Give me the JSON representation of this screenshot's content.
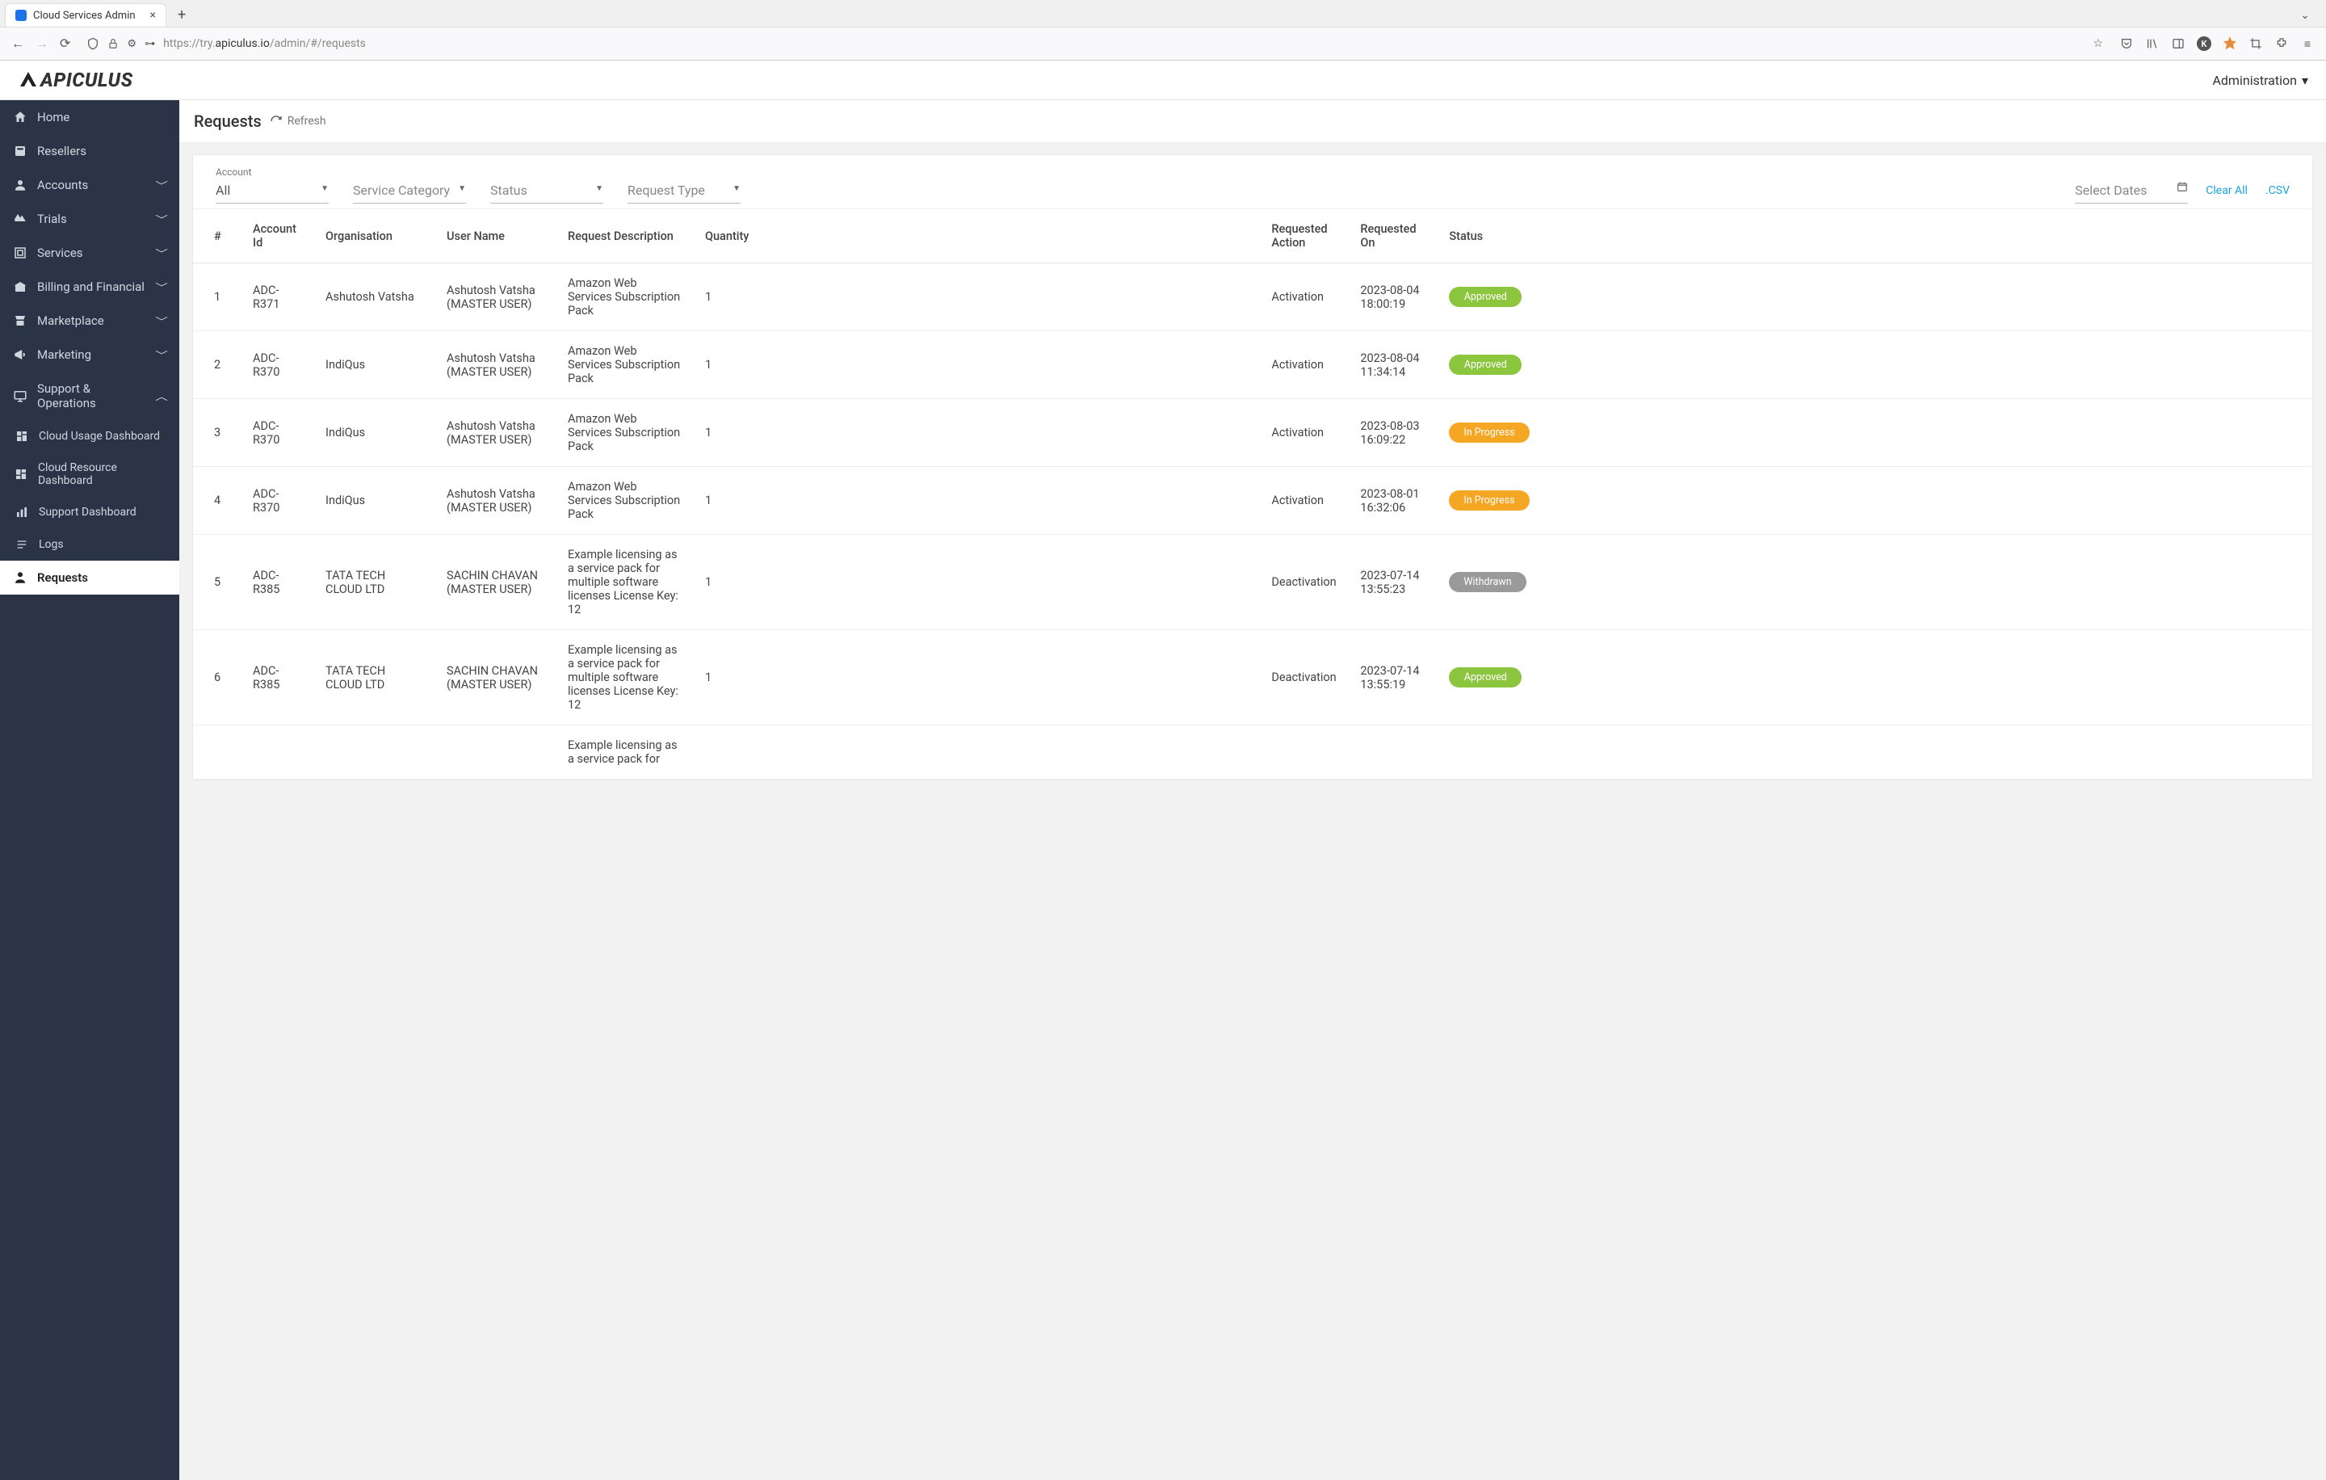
{
  "browser": {
    "tab_title": "Cloud Services Admin",
    "url_prefix": "https://try.",
    "url_host": "apiculus.io",
    "url_path": "/admin/#/requests"
  },
  "header": {
    "logo_text": "APICULUS",
    "admin_menu": "Administration"
  },
  "sidebar": {
    "items": [
      {
        "label": "Home"
      },
      {
        "label": "Resellers"
      },
      {
        "label": "Accounts",
        "expandable": true
      },
      {
        "label": "Trials",
        "expandable": true
      },
      {
        "label": "Services",
        "expandable": true
      },
      {
        "label": "Billing and Financial",
        "expandable": true
      },
      {
        "label": "Marketplace",
        "expandable": true
      },
      {
        "label": "Marketing",
        "expandable": true
      },
      {
        "label": "Support & Operations",
        "expanded": true,
        "subitems": [
          {
            "label": "Cloud Usage Dashboard"
          },
          {
            "label": "Cloud Resource Dashboard"
          },
          {
            "label": "Support Dashboard"
          },
          {
            "label": "Logs"
          }
        ]
      },
      {
        "label": "Requests",
        "active": true
      }
    ]
  },
  "page": {
    "title": "Requests",
    "refresh": "Refresh"
  },
  "filters": {
    "account_label": "Account",
    "account_value": "All",
    "service_category": "Service Category",
    "status": "Status",
    "request_type": "Request Type",
    "select_dates": "Select Dates",
    "clear_all": "Clear All",
    "csv": ".CSV"
  },
  "columns": [
    "#",
    "Account Id",
    "Organisation",
    "User Name",
    "Request Description",
    "Quantity",
    "Requested Action",
    "Requested On",
    "Status"
  ],
  "status_badges": {
    "Approved": "b-green",
    "In Progress": "b-orange",
    "Withdrawn": "b-grey"
  },
  "rows": [
    {
      "n": "1",
      "account": "ADC-R371",
      "org": "Ashutosh Vatsha",
      "user": "Ashutosh Vatsha (MASTER USER)",
      "desc": "Amazon Web Services Subscription Pack",
      "qty": "1",
      "action": "Activation",
      "on": "2023-08-04 18:00:19",
      "status": "Approved"
    },
    {
      "n": "2",
      "account": "ADC-R370",
      "org": "IndiQus",
      "user": "Ashutosh Vatsha (MASTER USER)",
      "desc": "Amazon Web Services Subscription Pack",
      "qty": "1",
      "action": "Activation",
      "on": "2023-08-04 11:34:14",
      "status": "Approved"
    },
    {
      "n": "3",
      "account": "ADC-R370",
      "org": "IndiQus",
      "user": "Ashutosh Vatsha (MASTER USER)",
      "desc": "Amazon Web Services Subscription Pack",
      "qty": "1",
      "action": "Activation",
      "on": "2023-08-03 16:09:22",
      "status": "In Progress"
    },
    {
      "n": "4",
      "account": "ADC-R370",
      "org": "IndiQus",
      "user": "Ashutosh Vatsha (MASTER USER)",
      "desc": "Amazon Web Services Subscription Pack",
      "qty": "1",
      "action": "Activation",
      "on": "2023-08-01 16:32:06",
      "status": "In Progress"
    },
    {
      "n": "5",
      "account": "ADC-R385",
      "org": "TATA TECH CLOUD LTD",
      "user": "SACHIN CHAVAN (MASTER USER)",
      "desc": "Example licensing as a service pack for multiple software licenses License Key: 12",
      "qty": "1",
      "action": "Deactivation",
      "on": "2023-07-14 13:55:23",
      "status": "Withdrawn"
    },
    {
      "n": "6",
      "account": "ADC-R385",
      "org": "TATA TECH CLOUD LTD",
      "user": "SACHIN CHAVAN (MASTER USER)",
      "desc": "Example licensing as a service pack for multiple software licenses License Key: 12",
      "qty": "1",
      "action": "Deactivation",
      "on": "2023-07-14 13:55:19",
      "status": "Approved"
    }
  ],
  "partial_row": {
    "desc": "Example licensing as a service pack for"
  }
}
